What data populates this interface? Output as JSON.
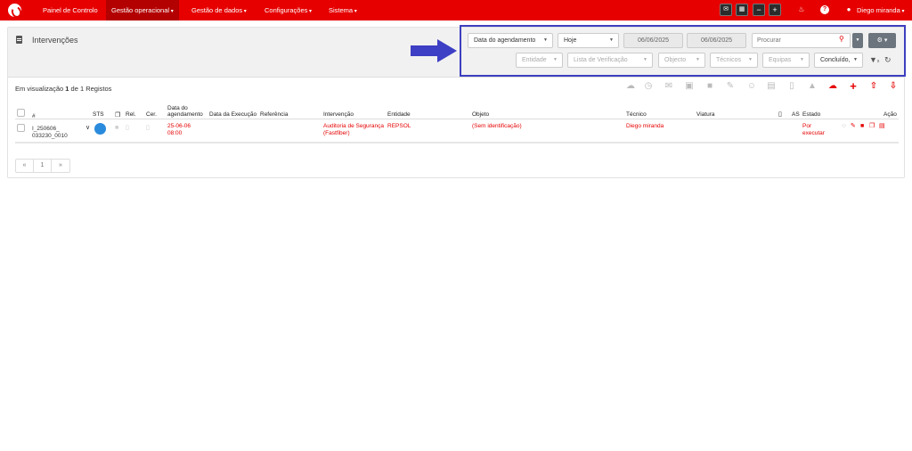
{
  "nav": {
    "items": [
      {
        "label": "Painel de Controlo"
      },
      {
        "label": "Gestão operacional"
      },
      {
        "label": "Gestão de dados"
      },
      {
        "label": "Configurações"
      },
      {
        "label": "Sistema"
      }
    ],
    "user_name": "Diego miranda",
    "accent": "#e60000"
  },
  "page": {
    "title": "Intervenções",
    "record_info_prefix": "Em visualização ",
    "record_info_current": "1",
    "record_info_mid": " de ",
    "record_info_total": "1",
    "record_info_suffix": " Registos"
  },
  "filters": {
    "date_field": "Data do agendamento",
    "period": "Hoje",
    "date_from": "06/06/2025",
    "date_to": "06/06/2025",
    "search_placeholder": "Procurar",
    "entidade": "Entidade",
    "lista": "Lista de Verificação",
    "objecto": "Objecto",
    "tecnicos": "Técnicos",
    "equipas": "Equipas",
    "estado": "Concluído,",
    "highlight_color": "#3d3fbf"
  },
  "table": {
    "headers": {
      "num": "#",
      "sts": "STS",
      "rel": "Rel.",
      "cer": "Cer.",
      "data_ag_1": "Data do",
      "data_ag_2": "agendamento",
      "data_exec": "Data da Execução",
      "referencia": "Referência",
      "intervencao": "Intervenção",
      "entidade": "Entidade",
      "objeto": "Objeto",
      "tecnico": "Técnico",
      "viatura": "Viatura",
      "as": "AS",
      "estado": "Estado",
      "acao": "Ação"
    },
    "rows": [
      {
        "id_1": "I_250606_",
        "id_2": "033230_0010",
        "date_1": "25-06-06",
        "date_2": "08:00",
        "intervencao_1": "Auditoria de Segurança",
        "intervencao_2": "(Fastfiber)",
        "entidade": "REPSOL",
        "objeto": "(Sem identificação)",
        "tecnico": "Diego miranda",
        "estado_1": "Por",
        "estado_2": "executar"
      }
    ]
  },
  "pager": {
    "first": "«",
    "page": "1",
    "next": "»"
  }
}
